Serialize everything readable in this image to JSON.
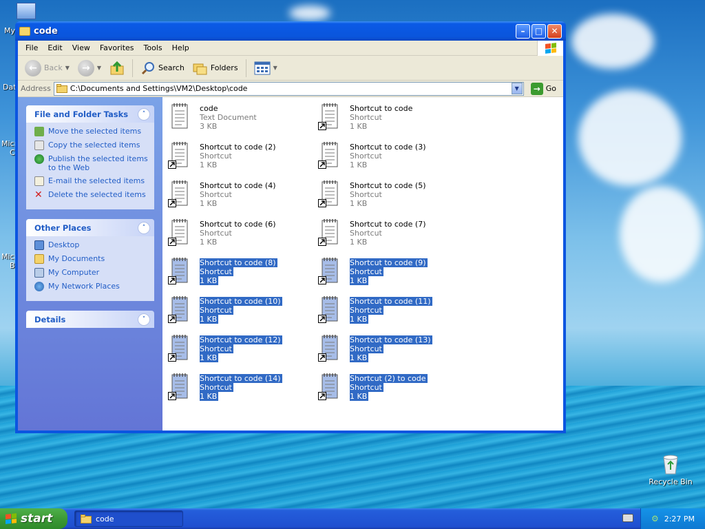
{
  "desktop": {
    "labels": [
      "My",
      "Dat",
      "Micro",
      "C",
      "Micro",
      "B"
    ],
    "recycle_bin": "Recycle Bin"
  },
  "window": {
    "title": "code",
    "menu": [
      "File",
      "Edit",
      "View",
      "Favorites",
      "Tools",
      "Help"
    ],
    "toolbar": {
      "back": "Back",
      "search": "Search",
      "folders": "Folders"
    },
    "address": {
      "label": "Address",
      "value": "C:\\Documents and Settings\\VM2\\Desktop\\code",
      "go": "Go"
    }
  },
  "task_pane": {
    "file_tasks": {
      "title": "File and Folder Tasks",
      "items": [
        "Move the selected items",
        "Copy the selected items",
        "Publish the selected items to the Web",
        "E-mail the selected items",
        "Delete the selected items"
      ]
    },
    "other_places": {
      "title": "Other Places",
      "items": [
        "Desktop",
        "My Documents",
        "My Computer",
        "My Network Places"
      ]
    },
    "details": {
      "title": "Details"
    }
  },
  "files": [
    {
      "name": "code",
      "type": "Text Document",
      "size": "3 KB",
      "selected": false,
      "shortcut": false
    },
    {
      "name": "Shortcut to code",
      "type": "Shortcut",
      "size": "1 KB",
      "selected": false,
      "shortcut": true
    },
    {
      "name": "Shortcut to code (2)",
      "type": "Shortcut",
      "size": "1 KB",
      "selected": false,
      "shortcut": true
    },
    {
      "name": "Shortcut to code (3)",
      "type": "Shortcut",
      "size": "1 KB",
      "selected": false,
      "shortcut": true
    },
    {
      "name": "Shortcut to code (4)",
      "type": "Shortcut",
      "size": "1 KB",
      "selected": false,
      "shortcut": true
    },
    {
      "name": "Shortcut to code (5)",
      "type": "Shortcut",
      "size": "1 KB",
      "selected": false,
      "shortcut": true
    },
    {
      "name": "Shortcut to code (6)",
      "type": "Shortcut",
      "size": "1 KB",
      "selected": false,
      "shortcut": true
    },
    {
      "name": "Shortcut to code (7)",
      "type": "Shortcut",
      "size": "1 KB",
      "selected": false,
      "shortcut": true
    },
    {
      "name": "Shortcut to code (8)",
      "type": "Shortcut",
      "size": "1 KB",
      "selected": true,
      "shortcut": true
    },
    {
      "name": "Shortcut to code (9)",
      "type": "Shortcut",
      "size": "1 KB",
      "selected": true,
      "shortcut": true
    },
    {
      "name": "Shortcut to code (10)",
      "type": "Shortcut",
      "size": "1 KB",
      "selected": true,
      "shortcut": true
    },
    {
      "name": "Shortcut to code (11)",
      "type": "Shortcut",
      "size": "1 KB",
      "selected": true,
      "shortcut": true
    },
    {
      "name": "Shortcut to code (12)",
      "type": "Shortcut",
      "size": "1 KB",
      "selected": true,
      "shortcut": true
    },
    {
      "name": "Shortcut to code (13)",
      "type": "Shortcut",
      "size": "1 KB",
      "selected": true,
      "shortcut": true
    },
    {
      "name": "Shortcut to code (14)",
      "type": "Shortcut",
      "size": "1 KB",
      "selected": true,
      "shortcut": true
    },
    {
      "name": "Shortcut (2) to code",
      "type": "Shortcut",
      "size": "1 KB",
      "selected": true,
      "shortcut": true
    }
  ],
  "taskbar": {
    "start": "start",
    "window_button": "code",
    "clock": "2:27 PM"
  },
  "colors": {
    "selection": "#316ac5",
    "task_link": "#215dc6",
    "title_blue": "#0b55e0"
  }
}
